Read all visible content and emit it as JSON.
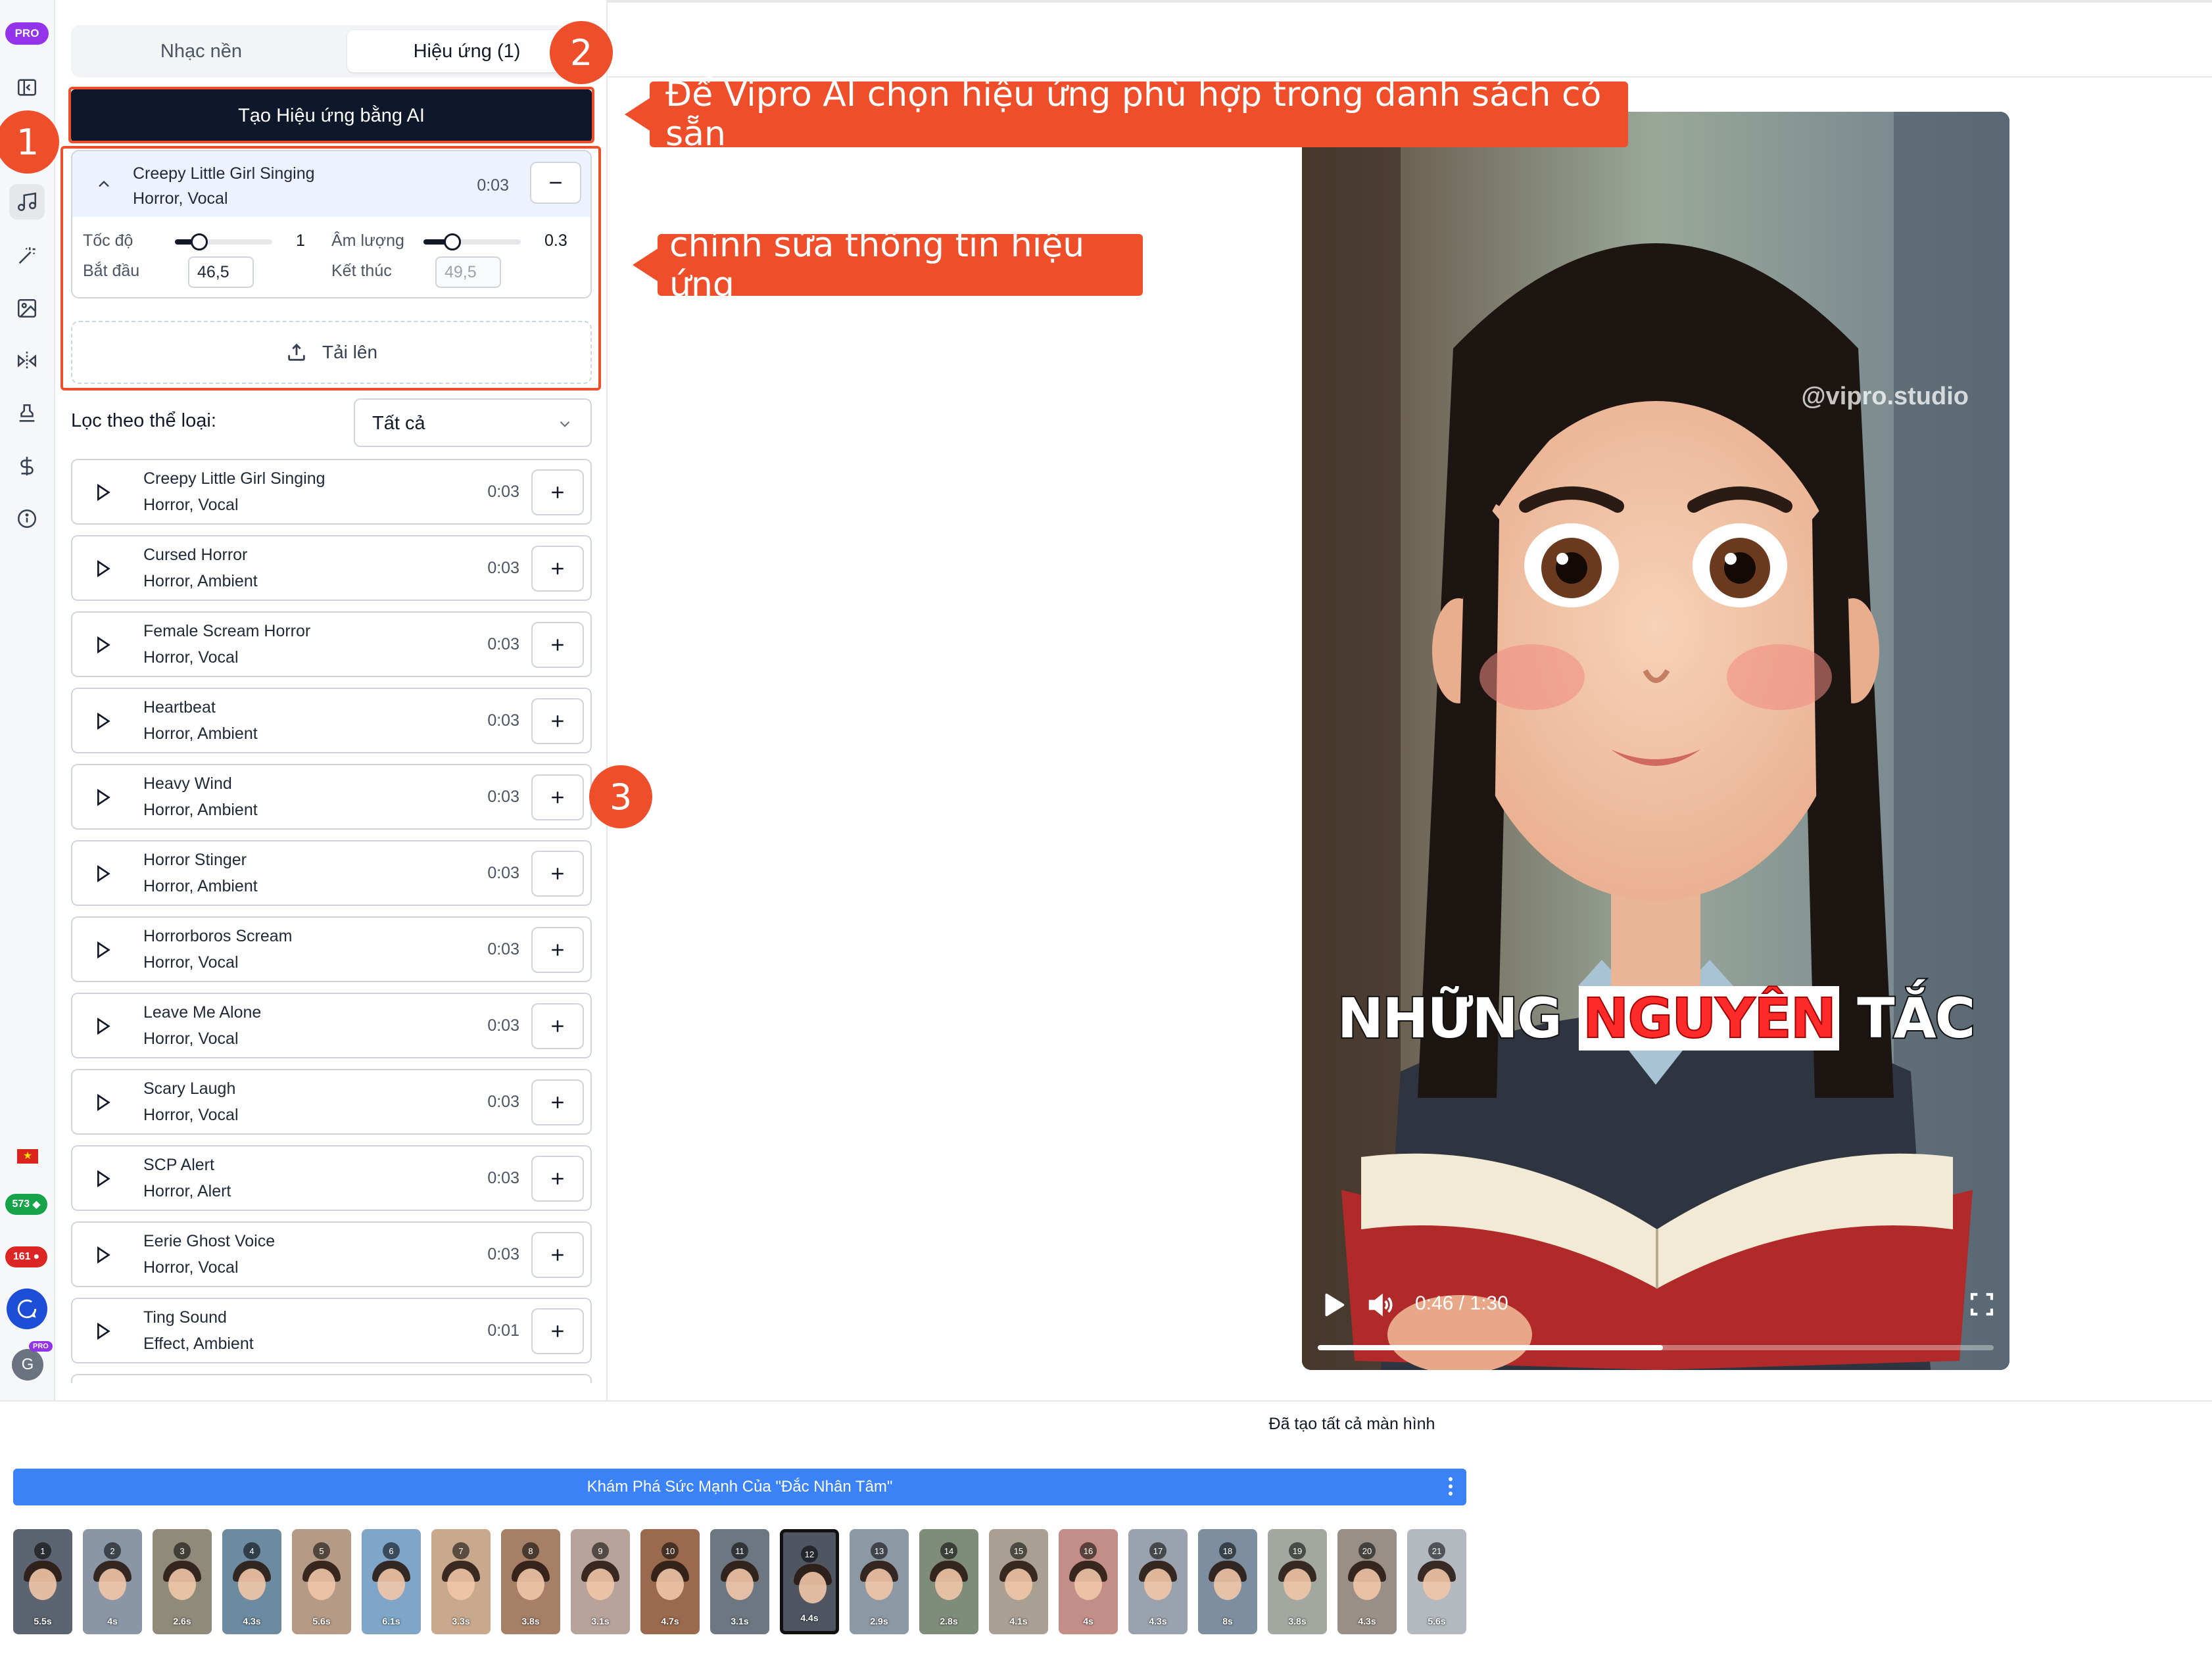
{
  "rail": {
    "pro_badge": "PRO",
    "icons": [
      "sidebar-toggle-icon",
      "music-icon",
      "magic-wand-icon",
      "image-edit-icon",
      "transition-icon",
      "stamp-icon",
      "dollar-icon",
      "info-icon"
    ],
    "active_icon": "music-icon",
    "credits_a": "573",
    "credits_b": "161",
    "avatar_letter": "G",
    "avatar_badge": "PRO",
    "accent_colors": {
      "pro": "#9333ea",
      "credits_a": "#16a34a",
      "credits_b": "#dc2626",
      "chat": "#1d4ed8"
    }
  },
  "panel": {
    "tabs": [
      {
        "label": "Nhạc nền",
        "selected": false
      },
      {
        "label": "Hiệu ứng (1)",
        "selected": true
      }
    ],
    "ai_button_label": "Tạo Hiệu ứng bằng AI",
    "selected_effect": {
      "title": "Creepy Little Girl Singing",
      "categories": "Horror, Vocal",
      "duration": "0:03",
      "speed_label": "Tốc độ",
      "speed_value": "1",
      "speed_fraction": 0.25,
      "volume_label": "Âm lượng",
      "volume_value": "0.3",
      "volume_fraction": 0.3,
      "start_label": "Bắt đầu",
      "start_value": "46,5",
      "end_label": "Kết thúc",
      "end_value": "49,5"
    },
    "upload_label": "Tải lên",
    "filter": {
      "label": "Lọc theo thể loại:",
      "selected": "Tất cả"
    },
    "sounds": [
      {
        "title": "Creepy Little Girl Singing",
        "categories": "Horror, Vocal",
        "duration": "0:03"
      },
      {
        "title": "Cursed Horror",
        "categories": "Horror, Ambient",
        "duration": "0:03"
      },
      {
        "title": "Female Scream Horror",
        "categories": "Horror, Vocal",
        "duration": "0:03"
      },
      {
        "title": "Heartbeat",
        "categories": "Horror, Ambient",
        "duration": "0:03"
      },
      {
        "title": "Heavy Wind",
        "categories": "Horror, Ambient",
        "duration": "0:03"
      },
      {
        "title": "Horror Stinger",
        "categories": "Horror, Ambient",
        "duration": "0:03"
      },
      {
        "title": "Horrorboros Scream",
        "categories": "Horror, Vocal",
        "duration": "0:03"
      },
      {
        "title": "Leave Me Alone",
        "categories": "Horror, Vocal",
        "duration": "0:03"
      },
      {
        "title": "Scary Laugh",
        "categories": "Horror, Vocal",
        "duration": "0:03"
      },
      {
        "title": "SCP Alert",
        "categories": "Horror, Alert",
        "duration": "0:03"
      },
      {
        "title": "Eerie Ghost Voice",
        "categories": "Horror, Vocal",
        "duration": "0:03"
      },
      {
        "title": "Ting Sound",
        "categories": "Effect, Ambient",
        "duration": "0:01"
      }
    ]
  },
  "video": {
    "watermark": "@vipro.studio",
    "caption": {
      "w1": "NHỮNG",
      "w2": "NGUYÊN",
      "w3": "TẮC"
    },
    "time": "0:46 / 1:30",
    "progress_fraction": 0.511
  },
  "bottom": {
    "status": "Đã tạo tất cả màn hình",
    "scene_title": "Khám Phá Sức Mạnh Của \"Đắc Nhân Tâm\"",
    "active_scene": 12,
    "scenes": [
      {
        "n": "1",
        "dur": "5.5s",
        "bg": "#5b6470"
      },
      {
        "n": "2",
        "dur": "4s",
        "bg": "#8a95a6"
      },
      {
        "n": "3",
        "dur": "2.6s",
        "bg": "#8f8a7a"
      },
      {
        "n": "4",
        "dur": "4.3s",
        "bg": "#6c8aa0"
      },
      {
        "n": "5",
        "dur": "5.6s",
        "bg": "#b59a86"
      },
      {
        "n": "6",
        "dur": "6.1s",
        "bg": "#7fa6c8"
      },
      {
        "n": "7",
        "dur": "3.3s",
        "bg": "#c9a98e"
      },
      {
        "n": "8",
        "dur": "3.8s",
        "bg": "#a57f66"
      },
      {
        "n": "9",
        "dur": "3.1s",
        "bg": "#b8a39a"
      },
      {
        "n": "10",
        "dur": "4.7s",
        "bg": "#9b6a4e"
      },
      {
        "n": "11",
        "dur": "3.1s",
        "bg": "#6d7782"
      },
      {
        "n": "12",
        "dur": "4.4s",
        "bg": "#4f5662"
      },
      {
        "n": "13",
        "dur": "2.9s",
        "bg": "#8d98a5"
      },
      {
        "n": "14",
        "dur": "2.8s",
        "bg": "#7f8c7a"
      },
      {
        "n": "15",
        "dur": "4.1s",
        "bg": "#a99f92"
      },
      {
        "n": "16",
        "dur": "4s",
        "bg": "#c38e87"
      },
      {
        "n": "17",
        "dur": "4.3s",
        "bg": "#9aa3ad"
      },
      {
        "n": "18",
        "dur": "8s",
        "bg": "#7d8ea1"
      },
      {
        "n": "19",
        "dur": "3.8s",
        "bg": "#a2a7a0"
      },
      {
        "n": "20",
        "dur": "4.3s",
        "bg": "#9a8f86"
      },
      {
        "n": "21",
        "dur": "5.6s",
        "bg": "#b4b8bf"
      }
    ]
  },
  "annotations": {
    "marker_1": "1",
    "marker_2": "2",
    "marker_3": "3",
    "callout_ai": "Để Vipro AI chọn hiệu ứng phù hợp trong danh sách có sẵn",
    "callout_edit": "chỉnh sửa thông tin hiệu ứng",
    "color": "#ef4e2b"
  }
}
